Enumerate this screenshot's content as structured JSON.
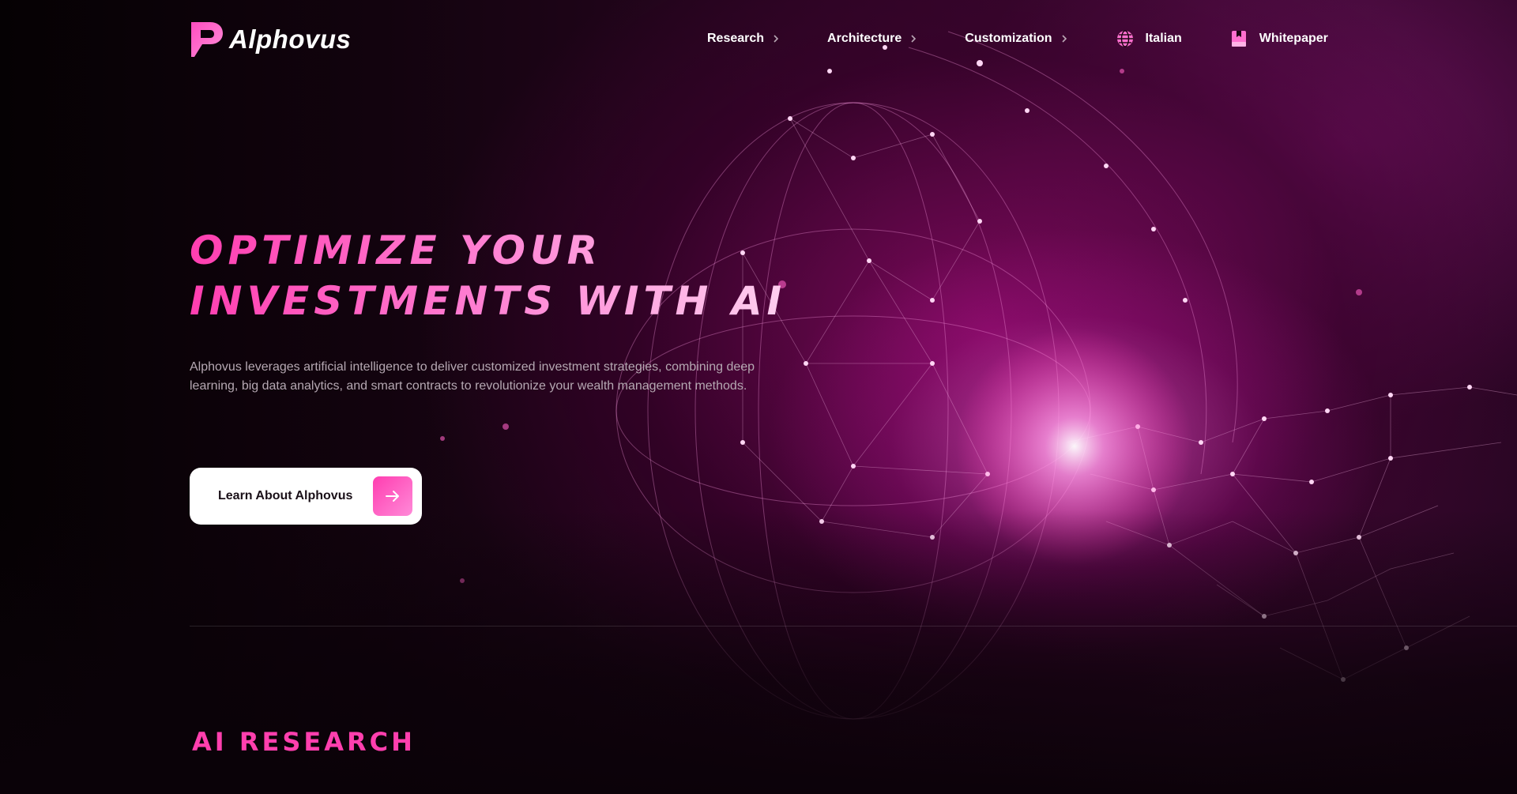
{
  "brand": {
    "name": "Alphovus"
  },
  "nav": {
    "items": [
      {
        "label": "Research"
      },
      {
        "label": "Architecture"
      },
      {
        "label": "Customization"
      }
    ],
    "language": "Italian",
    "whitepaper": "Whitepaper"
  },
  "hero": {
    "headline_line1": "OPTIMIZE YOUR",
    "headline_line2": "INVESTMENTS WITH AI",
    "description": "Alphovus leverages artificial intelligence to deliver customized investment strategies, combining deep learning, big data analytics, and smart contracts to revolutionize your wealth management methods.",
    "cta_label": "Learn About Alphovus"
  },
  "sections": {
    "ai_research_title": "AI RESEARCH"
  },
  "colors": {
    "accent": "#ff3fae",
    "accent_light": "#ff8ad8",
    "background": "#0a0208"
  },
  "icons": {
    "nav_chevron": "chevron-right-icon",
    "language": "globe-icon",
    "whitepaper": "book-icon",
    "cta": "arrow-right-icon"
  }
}
